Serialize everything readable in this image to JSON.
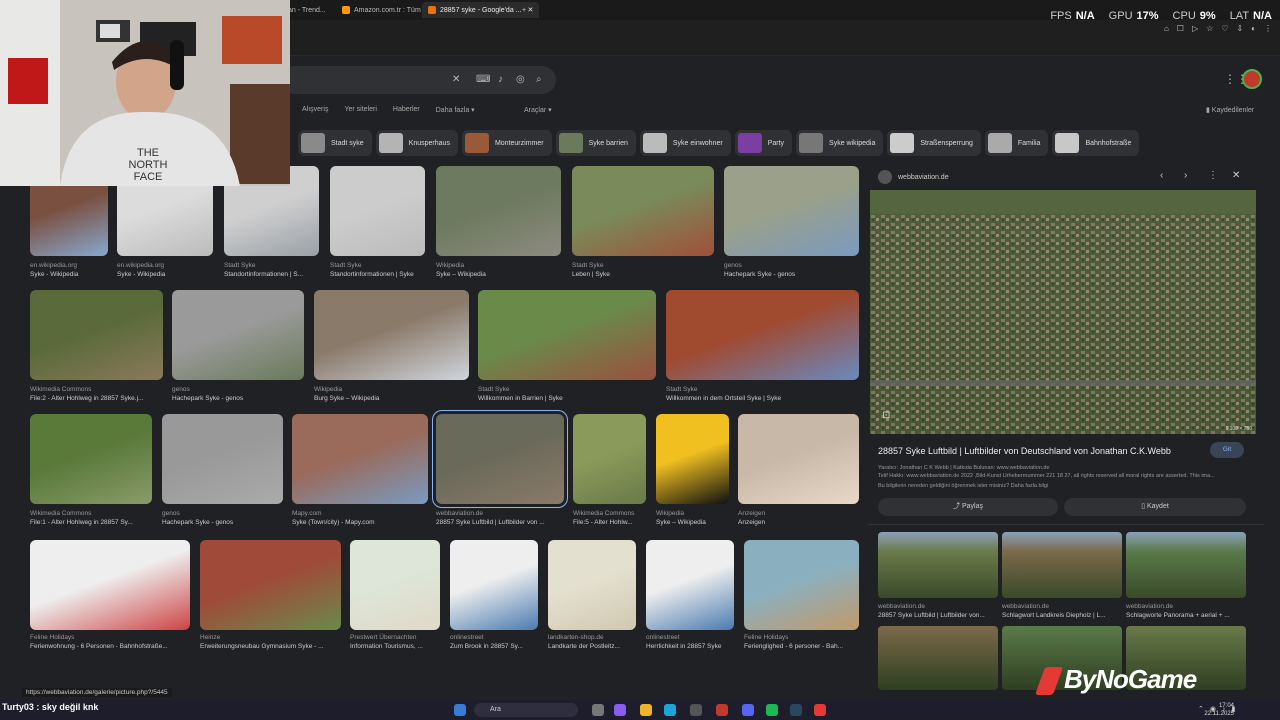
{
  "browser": {
    "tabs": [
      {
        "label": "an - Trend..."
      },
      {
        "label": "Amazon.com.tr : Tüm Ka..."
      },
      {
        "label": "28857 syke - Google'da ..."
      }
    ],
    "new_tab": "+"
  },
  "overlay": {
    "fps_label": "FPS",
    "fps_value": "N/A",
    "gpu_label": "GPU",
    "gpu_value": "17%",
    "cpu_label": "CPU",
    "cpu_value": "9%",
    "lat_label": "LAT",
    "lat_value": "N/A"
  },
  "search": {
    "nav_tabs": [
      "Alışveriş",
      "Yer siteleri",
      "Haberler",
      "Daha fazla ▾"
    ],
    "tools": "Araçlar ▾",
    "saved": "Kaydedilenler"
  },
  "chips": [
    {
      "label": "Stadt syke",
      "color": "#8a8a8a"
    },
    {
      "label": "Knusperhaus",
      "color": "#b4b4b4"
    },
    {
      "label": "Monteurzimmer",
      "color": "#9a5a3a"
    },
    {
      "label": "Syke barrien",
      "color": "#6a7a5a"
    },
    {
      "label": "Syke einwohner",
      "color": "#bbbbbb"
    },
    {
      "label": "Party",
      "color": "#7a3fa0"
    },
    {
      "label": "Syke wikipedia",
      "color": "#777777"
    },
    {
      "label": "Straßensperrung",
      "color": "#cccccc"
    },
    {
      "label": "Familia",
      "color": "#aaaaaa"
    },
    {
      "label": "Bahnhofstraße",
      "color": "#c8c8c8"
    }
  ],
  "results": {
    "row1": [
      {
        "source": "en.wikipedia.org",
        "title": "Syke - Wikipedia"
      },
      {
        "source": "en.wikipedia.org",
        "title": "Syke - Wikipedia"
      },
      {
        "source": "Stadt Syke",
        "title": "Standortinformationen | S..."
      },
      {
        "source": "Stadt Syke",
        "title": "Standortinformationen | Syke"
      },
      {
        "source": "Wikipedia",
        "title": "Syke – Wikipedia"
      },
      {
        "source": "Stadt Syke",
        "title": "Leben | Syke"
      },
      {
        "source": "genos",
        "title": "Hachepark Syke - genos"
      }
    ],
    "row2": [
      {
        "source": "Wikimedia Commons",
        "title": "File:2 - Alter Hohlweg in 28857 Syke.j..."
      },
      {
        "source": "genos",
        "title": "Hachepark Syke - genos"
      },
      {
        "source": "Wikipedia",
        "title": "Burg Syke – Wikipedia"
      },
      {
        "source": "Stadt Syke",
        "title": "Willkommen in Barrien | Syke"
      },
      {
        "source": "Stadt Syke",
        "title": "Willkommen in dem Ortsteil Syke | Syke"
      }
    ],
    "row3": [
      {
        "source": "Wikimedia Commons",
        "title": "File:1 - Alter Hohlweg in 28857 Sy..."
      },
      {
        "source": "genos",
        "title": "Hachepark Syke - genos"
      },
      {
        "source": "Mapy.com",
        "title": "Syke (Town/city) - Mapy.com"
      },
      {
        "source": "webbaviation.de",
        "title": "28857 Syke Luftbild | Luftbilder von ..."
      },
      {
        "source": "Wikimedia Commons",
        "title": "File:5 - Alter Hohlw..."
      },
      {
        "source": "Wikipedia",
        "title": "Syke – Wikipedia"
      },
      {
        "source": "Anzeigen",
        "title": "Anzeigen"
      }
    ],
    "row4": [
      {
        "source": "Feline Holidays",
        "title": "Ferienwohnung - 6 Personen - Bahnhofstraße..."
      },
      {
        "source": "Heinze",
        "title": "Erweiterungsneubau Gymnasium Syke - ..."
      },
      {
        "source": "Prestwert Übernachten",
        "title": "Information Tourismus, ..."
      },
      {
        "source": "onlinestreet",
        "title": "Zum Brook in 28857 Sy..."
      },
      {
        "source": "landkarten-shop.de",
        "title": "Landkarte der Postleitz..."
      },
      {
        "source": "onlinestreet",
        "title": "Herrlichkeit in 28857 Syke"
      },
      {
        "source": "Feline Holidays",
        "title": "Ferienglighed - 6 personer - Bah..."
      }
    ]
  },
  "panel": {
    "site": "webbaviation.de",
    "title": "28857 Syke Luftbild | Luftbilder von Deutschland von Jonathan C.K.Webb",
    "visit": "Git",
    "meta1": "Yaratıcı: Jonathan C K Webb | Katkıda Bulunan: www.webbaviation.de",
    "meta2": "Telif Hakkı: www.webbaviation.de 2022 ,Bild-Kunst Urheberrnummer 221 18 27, all rights reserved all moral rights are asserted. This ima...",
    "meta3": "Bu bilgilerin nereden geldiğini öğrenmek ister misiniz? Daha fazla bilgi",
    "share": "Paylaş",
    "save": "Kaydet",
    "img_size": "1,100 × 750",
    "related": [
      {
        "source": "webbaviation.de",
        "title": "28857 Syke Luftbild | Luftbilder von..."
      },
      {
        "source": "webbaviation.de",
        "title": "Schlagwort Landkreis Diepholz | L..."
      },
      {
        "source": "webbaviation.de",
        "title": "Schlagworte Panorama + aerial + ..."
      }
    ]
  },
  "status_url": "https://webbaviation.de/galerie/picture.php?/5445",
  "chat": "Turty03 : sky değil knk",
  "brand": "ByNoGame",
  "taskbar": {
    "search": "Ara",
    "time": "17:04",
    "date": "22.11.2025"
  }
}
